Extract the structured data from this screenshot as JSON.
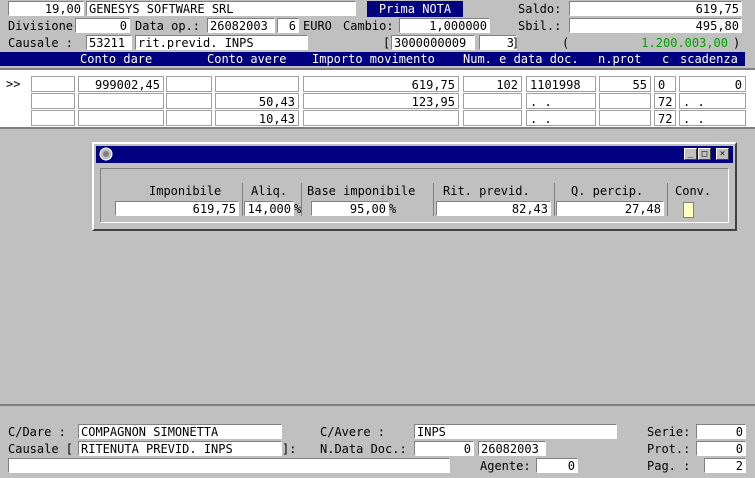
{
  "header": {
    "code": "19,00",
    "company": "GENESYS SOFTWARE SRL",
    "title": "Prima NOTA",
    "saldo_label": "Saldo:",
    "saldo_value": "619,75",
    "divisione_label": "Divisione:",
    "divisione_value": "0",
    "data_op_label": "Data op.:",
    "data_op_value": "26082003",
    "data_op_extra": "6",
    "euro_label": "EURO",
    "cambio_label": "Cambio:",
    "cambio_value": "1,000000",
    "sbil_label": "Sbil.:",
    "sbil_value": "495,80",
    "causale_label": "Causale  :",
    "causale_code": "53211",
    "causale_desc": "rit.previd. INPS",
    "ref_open": "[",
    "ref_value": "3000000009",
    "ref_num": "3",
    "ref_close": "]",
    "paren_open": "(",
    "paren_value": "1.200.003,00",
    "paren_close": ")"
  },
  "columns": {
    "conto_dare": "Conto dare",
    "conto_avere": "Conto avere",
    "importo": "Importo movimento",
    "num_data": "Num. e data doc.",
    "nprot": "n.prot",
    "c": "c",
    "scadenza": "scadenza"
  },
  "rows": [
    {
      "marker": ">>",
      "dare": "999002,45",
      "avere": "",
      "importo": "619,75",
      "num": "102",
      "data": "1101998",
      "prot": "55",
      "c": "0",
      "scad": "0",
      "scad_dots": ".  ."
    },
    {
      "marker": "",
      "dare": "",
      "avere": "50,43",
      "importo": "123,95",
      "num": "",
      "data": ".  .",
      "prot": "",
      "c": "72",
      "scad": "",
      "scad_dots": ".  ."
    },
    {
      "marker": "",
      "dare": "",
      "avere": "10,43",
      "importo": "",
      "num": "",
      "data": ".  .",
      "prot": "",
      "c": "72",
      "scad": "",
      "scad_dots": ".  ."
    }
  ],
  "dialog": {
    "imponibile_label": "Imponibile",
    "imponibile_value": "619,75",
    "aliq_label": "Aliq.",
    "aliq_value": "14,000",
    "aliq_unit": "%",
    "base_label": "Base imponibile",
    "base_value": "95,00",
    "base_unit": "%",
    "rit_label": "Rit. previd.",
    "rit_value": "82,43",
    "qpercip_label": "Q. percip.",
    "qpercip_value": "27,48",
    "conv_label": "Conv."
  },
  "footer": {
    "cdare_label": "C/Dare   :",
    "cdare_value": "COMPAGNON SIMONETTA",
    "cavere_label": "C/Avere  :",
    "cavere_value": "INPS",
    "serie_label": "Serie:",
    "serie_value": "0",
    "causale_label": "Causale [",
    "causale_value": "RITENUTA PREVID. INPS",
    "causale_close": "]:",
    "ndata_label": "N.Data Doc.:",
    "ndata_num": "0",
    "ndata_date": "26082003",
    "prot_label": "Prot.:",
    "prot_value": "0",
    "agente_label": "Agente:",
    "agente_value": "0",
    "pag_label": "Pag. :",
    "pag_value": "2"
  }
}
